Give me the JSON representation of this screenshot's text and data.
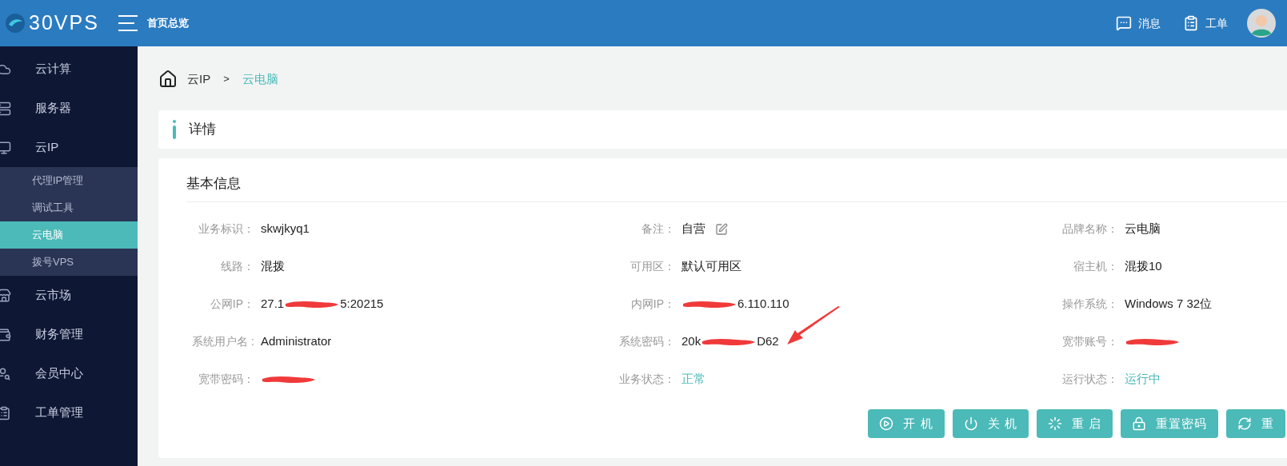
{
  "header": {
    "logo_text": "30VPS",
    "nav_label": "首页总览",
    "actions": [
      {
        "label": "消息"
      },
      {
        "label": "工单"
      }
    ]
  },
  "sidebar": {
    "items": [
      {
        "label": "云计算",
        "selected": false
      },
      {
        "label": "服务器",
        "selected": false
      },
      {
        "label": "云IP",
        "selected": false,
        "children": [
          {
            "label": "代理IP管理",
            "selected": false
          },
          {
            "label": "调试工具",
            "selected": false
          },
          {
            "label": "云电脑",
            "selected": true
          },
          {
            "label": "拨号VPS",
            "selected": false
          }
        ]
      },
      {
        "label": "云市场",
        "selected": false
      },
      {
        "label": "财务管理",
        "selected": false
      },
      {
        "label": "会员中心",
        "selected": false
      },
      {
        "label": "工单管理",
        "selected": false
      }
    ]
  },
  "breadcrumb": [
    {
      "label": "云IP",
      "selected": false
    },
    {
      "label": "云电脑",
      "selected": true
    }
  ],
  "breadcrumb_separator": ">",
  "section_title": "详情",
  "card_title": "基本信息",
  "fields": [
    {
      "label": "业务标识：",
      "kind": "text",
      "value": "skwjkyq1"
    },
    {
      "label": "备注：",
      "kind": "editable",
      "value": "自营"
    },
    {
      "label": "品牌名称：",
      "kind": "text",
      "value": "云电脑"
    },
    {
      "label": "线路：",
      "kind": "text",
      "value": "混拨"
    },
    {
      "label": "可用区：",
      "kind": "text",
      "value": "默认可用区"
    },
    {
      "label": "宿主机：",
      "kind": "text",
      "value": "混拨10"
    },
    {
      "label": "公网IP：",
      "kind": "redacted",
      "before": "27.1",
      "after": "5:20215"
    },
    {
      "label": "内网IP：",
      "kind": "redacted",
      "after": "6.110.110"
    },
    {
      "label": "操作系统：",
      "kind": "text",
      "value": "Windows 7 32位"
    },
    {
      "label": "系统用户名 :",
      "kind": "text",
      "value": "Administrator"
    },
    {
      "label": "系统密码：",
      "kind": "redacted",
      "before": "20k",
      "after": "D62"
    },
    {
      "label": "宽带账号：",
      "kind": "redacted"
    },
    {
      "label": "宽带密码：",
      "kind": "redacted"
    },
    {
      "label": "业务状态：",
      "kind": "status",
      "value": "正常"
    },
    {
      "label": "运行状态：",
      "kind": "status",
      "value": "运行中"
    }
  ],
  "annotation": {
    "kind": "arrow"
  },
  "buttons": [
    {
      "label": "开 机"
    },
    {
      "label": "关 机"
    },
    {
      "label": "重 启"
    },
    {
      "label": "重置密码"
    },
    {
      "label": "重"
    }
  ]
}
